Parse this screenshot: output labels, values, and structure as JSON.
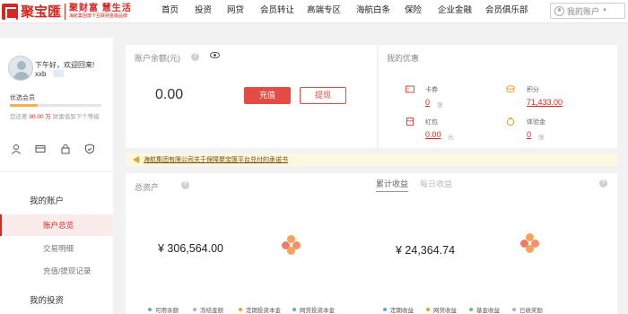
{
  "brand": {
    "name": "聚宝匯",
    "slogan": "聚财富 慧生活",
    "subtitle": "海航集团旗下互联网金融品牌"
  },
  "nav": {
    "items": [
      "首页",
      "投资",
      "网贷",
      "会员转让",
      "高端专区",
      "海航白条",
      "保险",
      "企业金融",
      "会员俱乐部"
    ],
    "account": "我的账户"
  },
  "sidebar": {
    "greeting": "下午好，欢迎回来!",
    "username": "xxb",
    "level": "优选会员",
    "level_progress": 0.3,
    "upgrade_prefix": "您还差",
    "upgrade_amount": "90.00 万",
    "upgrade_suffix": "财富值到下个等级",
    "groups": [
      {
        "label": "我的账户",
        "items": [
          "账户总览",
          "交易明细",
          "充值/提现记录"
        ]
      },
      {
        "label": "我的投资",
        "items": []
      }
    ],
    "active_item": "账户总览"
  },
  "balance": {
    "label": "账户余额(元)",
    "value": "0.00",
    "recharge": "充值",
    "withdraw": "提现"
  },
  "benefits": {
    "title": "我的优惠",
    "items": [
      {
        "label": "卡券",
        "value": "0",
        "unit": "张",
        "icon": "ticket-icon"
      },
      {
        "label": "积分",
        "value": "71,433.00",
        "unit": "",
        "icon": "coins-icon"
      },
      {
        "label": "红包",
        "value": "0.00",
        "unit": "元",
        "icon": "red-packet-icon"
      },
      {
        "label": "体验金",
        "value": "0",
        "unit": "张",
        "icon": "experience-gold-icon"
      }
    ]
  },
  "notice": {
    "text": "海航集团有限公司关于保障聚宝匯平台兑付的承诺书"
  },
  "assets": {
    "total_label": "总资产",
    "total_value": "¥ 306,564.00",
    "tabs": [
      "累计收益",
      "每日收益"
    ],
    "earnings_value": "¥ 24,364.74",
    "total_legend": [
      {
        "label": "可用余额",
        "color": "#5aa9e6"
      },
      {
        "label": "冻结金额",
        "color": "#c9a0dc"
      },
      {
        "label": "定期投资本金",
        "color": "#f0a020"
      },
      {
        "label": "网贷投资本金",
        "color": "#5aa9e6"
      }
    ],
    "earn_legend": [
      {
        "label": "定期收益",
        "color": "#5aa9e6"
      },
      {
        "label": "网贷收益",
        "color": "#f0a020"
      },
      {
        "label": "基金收益",
        "color": "#6cc07a"
      },
      {
        "label": "已收奖励",
        "color": "#c9a0dc"
      }
    ]
  }
}
